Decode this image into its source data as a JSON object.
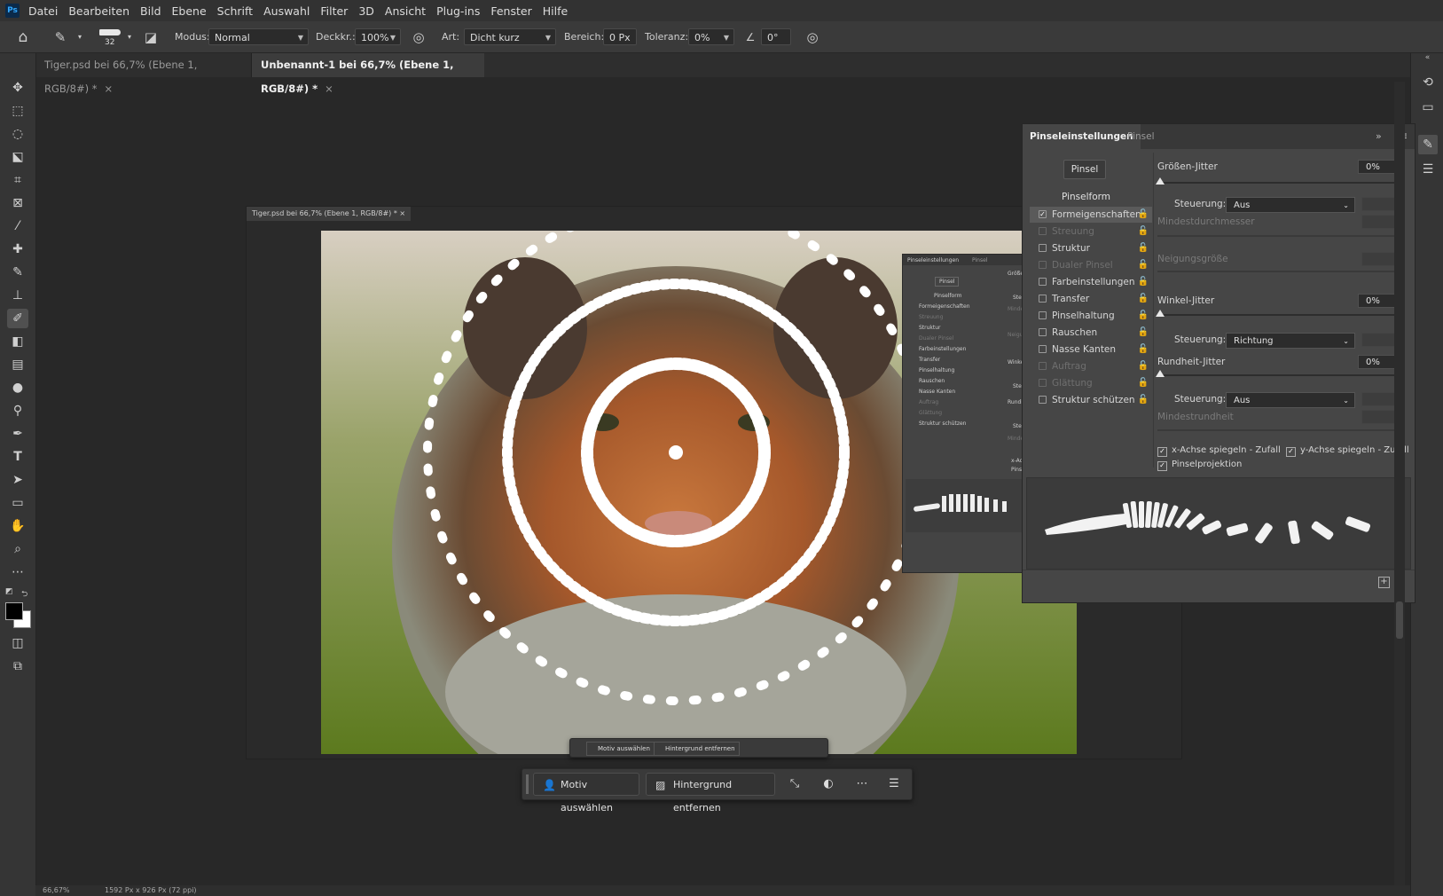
{
  "app": {
    "logo": "Ps"
  },
  "menu": [
    "Datei",
    "Bearbeiten",
    "Bild",
    "Ebene",
    "Schrift",
    "Auswahl",
    "Filter",
    "3D",
    "Ansicht",
    "Plug-ins",
    "Fenster",
    "Hilfe"
  ],
  "options": {
    "brush_size": "32",
    "modus_label": "Modus:",
    "modus_value": "Normal",
    "deckkr_label": "Deckkr.:",
    "deckkr_value": "100%",
    "art_label": "Art:",
    "art_value": "Dicht kurz",
    "bereich_label": "Bereich:",
    "bereich_value": "0 Px",
    "toleranz_label": "Toleranz:",
    "toleranz_value": "0%",
    "angle_value": "0°"
  },
  "tabs": [
    {
      "label": "Tiger.psd bei 66,7% (Ebene 1, RGB/8#) *",
      "active": false
    },
    {
      "label": "Unbenannt-1 bei 66,7% (Ebene 1, RGB/8#) *",
      "active": true
    }
  ],
  "doc_window_title": "Tiger.psd bei 66,7% (Ebene 1, RGB/8#) *",
  "brush_panel": {
    "tab_active": "Pinseleinstellungen",
    "tab_other": "Pinsel",
    "pinsel_button": "Pinsel",
    "section_header": "Pinselform",
    "items": [
      {
        "label": "Formeigenschaften",
        "checked": true,
        "enabled": true,
        "selected": true
      },
      {
        "label": "Streuung",
        "checked": false,
        "enabled": false
      },
      {
        "label": "Struktur",
        "checked": false,
        "enabled": true
      },
      {
        "label": "Dualer Pinsel",
        "checked": false,
        "enabled": false
      },
      {
        "label": "Farbeinstellungen",
        "checked": false,
        "enabled": true
      },
      {
        "label": "Transfer",
        "checked": false,
        "enabled": true
      },
      {
        "label": "Pinselhaltung",
        "checked": false,
        "enabled": true
      },
      {
        "label": "Rauschen",
        "checked": false,
        "enabled": true
      },
      {
        "label": "Nasse Kanten",
        "checked": false,
        "enabled": true
      },
      {
        "label": "Auftrag",
        "checked": false,
        "enabled": false
      },
      {
        "label": "Glättung",
        "checked": false,
        "enabled": false
      },
      {
        "label": "Struktur schützen",
        "checked": false,
        "enabled": true
      }
    ],
    "groessen_jitter_label": "Größen-Jitter",
    "groessen_jitter_value": "0%",
    "steuerung_label": "Steuerung:",
    "steuerung1_value": "Aus",
    "mindestdurchmesser_label": "Mindestdurchmesser",
    "neigungsgroesse_label": "Neigungsgröße",
    "winkel_jitter_label": "Winkel-Jitter",
    "winkel_jitter_value": "0%",
    "steuerung2_value": "Richtung",
    "rundheit_jitter_label": "Rundheit-Jitter",
    "rundheit_jitter_value": "0%",
    "steuerung3_value": "Aus",
    "mindestrundheit_label": "Mindestrundheit",
    "x_achse_label": "x-Achse spiegeln - Zufall",
    "y_achse_label": "y-Achse spiegeln - Zufall",
    "pinselprojektion_label": "Pinselprojektion"
  },
  "ghost_panel": {
    "tab_active": "Pinseleinstellungen",
    "tab_other": "Pinsel",
    "pinsel_button": "Pinsel",
    "section_header": "Pinselform",
    "items": [
      "Formeigenschaften",
      "Streuung",
      "Struktur",
      "Dualer Pinsel",
      "Farbeinstellungen",
      "Transfer",
      "Pinselhaltung",
      "Rauschen",
      "Nasse Kanten",
      "Auftrag",
      "Glättung",
      "Struktur schützen"
    ],
    "r_groessen": "Größen-",
    "r_steue1": "Steue",
    "r_mindest": "Mindest",
    "r_neigung": "Neigung",
    "r_winkel": "Winkel-Jitt",
    "r_steue2": "Steue",
    "r_rundheit": "Rundheit",
    "r_steue3": "Steue",
    "r_mindestr": "Mindestr",
    "r_xachse": "x-Achse",
    "r_pinselpro": "Pinselpro"
  },
  "task_bar": {
    "motiv": "Motiv auswählen",
    "hintergrund": "Hintergrund entfernen"
  },
  "task_bar_small": {
    "motiv": "Motiv auswählen",
    "hintergrund": "Hintergrund entfernen"
  },
  "status": {
    "zoom": "66,67%",
    "dims": "1592 Px x 926 Px (72 ppi)"
  },
  "colors": {
    "accent": "#31a8ff",
    "bg": "#282828",
    "panel": "#464646"
  }
}
